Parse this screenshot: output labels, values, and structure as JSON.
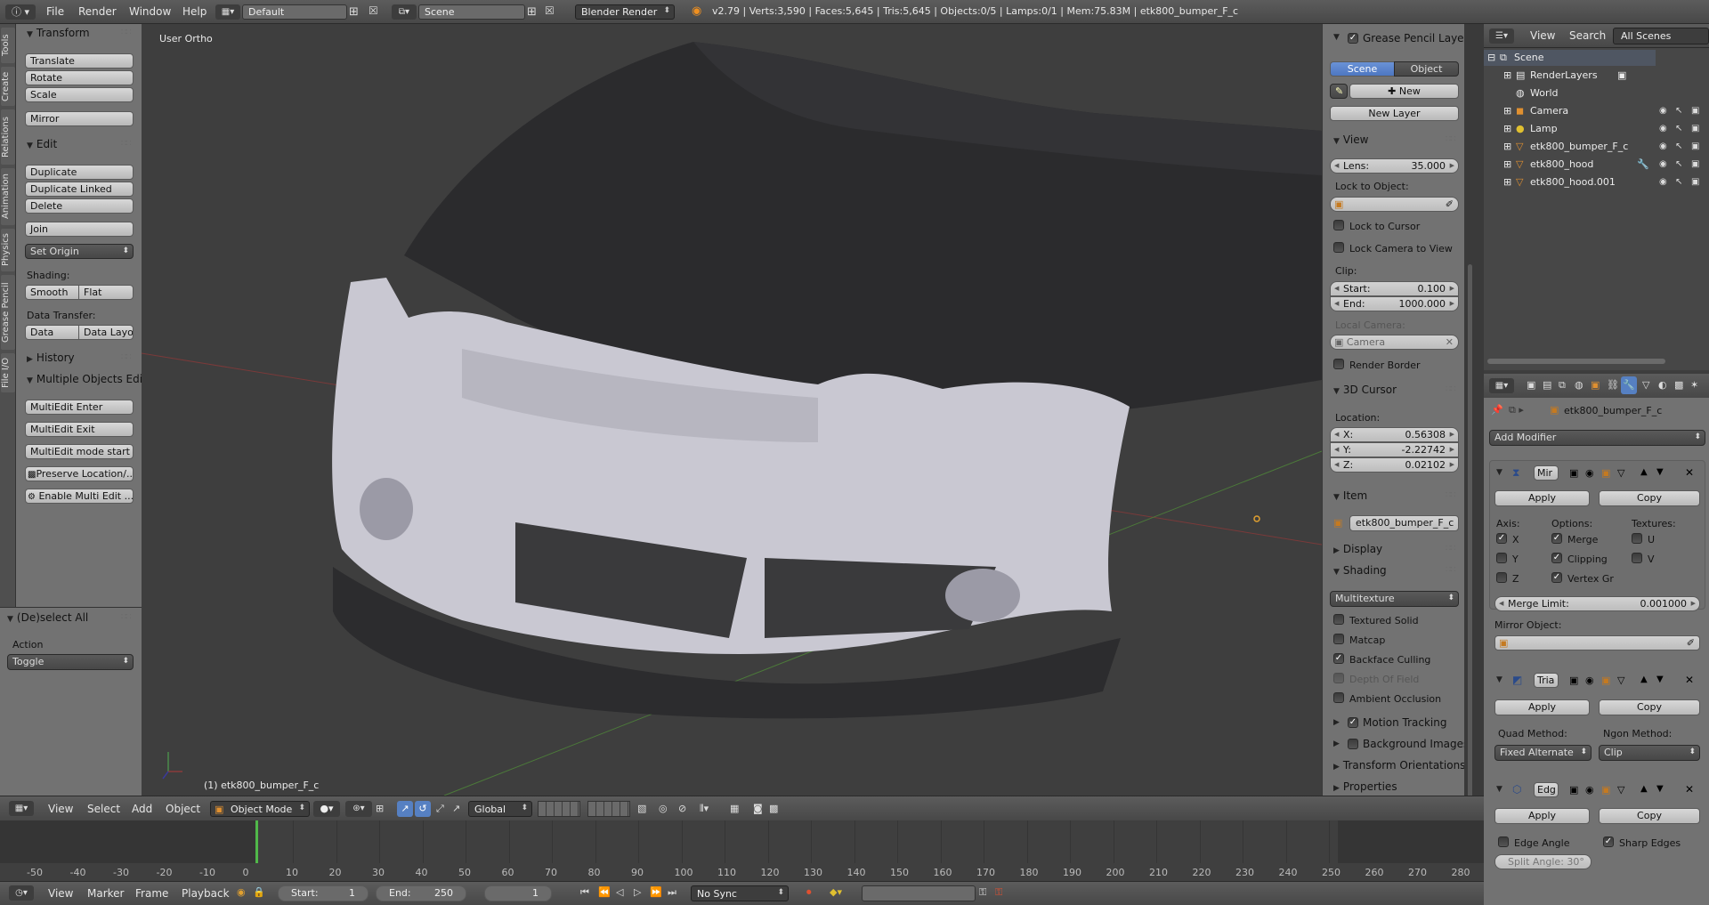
{
  "topbar": {
    "menus": [
      "File",
      "Render",
      "Window",
      "Help"
    ],
    "layout": "Default",
    "scene": "Scene",
    "engine": "Blender Render",
    "stats": "v2.79 | Verts:3,590 | Faces:5,645 | Tris:5,645 | Objects:0/5 | Lamps:0/1 | Mem:75.83M | etk800_bumper_F_c"
  },
  "tabs": [
    "Tools",
    "Create",
    "Relations",
    "Animation",
    "Physics",
    "Grease Pencil",
    "File I/O"
  ],
  "toolshelf": {
    "transform": {
      "title": "Transform",
      "buttons": [
        "Translate",
        "Rotate",
        "Scale",
        "Mirror"
      ]
    },
    "edit": {
      "title": "Edit",
      "buttons": [
        "Duplicate",
        "Duplicate Linked",
        "Delete",
        "Join"
      ],
      "set_origin": "Set Origin",
      "shading_label": "Shading:",
      "smooth": "Smooth",
      "flat": "Flat",
      "data_transfer_label": "Data Transfer:",
      "data": "Data",
      "data_layo": "Data Layo"
    },
    "history": "History",
    "multi": {
      "title": "Multiple Objects Edit",
      "buttons": [
        "MultiEdit Enter",
        "MultiEdit Exit",
        "MultiEdit mode start",
        "Preserve Location/...",
        "Enable Multi Edit ..."
      ]
    }
  },
  "operator": {
    "title": "(De)select All",
    "action_label": "Action",
    "action_value": "Toggle"
  },
  "viewport": {
    "view_name": "User Ortho",
    "object_label": "(1) etk800_bumper_F_c"
  },
  "npanel": {
    "grease": {
      "title": "Grease Pencil Layers",
      "scene": "Scene",
      "object": "Object",
      "new": "New",
      "new_layer": "New Layer"
    },
    "view": {
      "title": "View",
      "lens_label": "Lens:",
      "lens_value": "35.000",
      "lock_to_object": "Lock to Object:",
      "lock_cursor": "Lock to Cursor",
      "lock_camera": "Lock Camera to View",
      "clip": "Clip:",
      "start_label": "Start:",
      "start_value": "0.100",
      "end_label": "End:",
      "end_value": "1000.000",
      "local_camera": "Local Camera:",
      "camera": "Camera",
      "render_border": "Render Border"
    },
    "cursor": {
      "title": "3D Cursor",
      "location": "Location:",
      "x_label": "X:",
      "x": "0.56308",
      "y_label": "Y:",
      "y": "-2.22742",
      "z_label": "Z:",
      "z": "0.02102"
    },
    "item": {
      "title": "Item",
      "name": "etk800_bumper_F_c"
    },
    "display": "Display",
    "shading": {
      "title": "Shading",
      "mode": "Multitexture",
      "options": [
        "Textured Solid",
        "Matcap",
        "Backface Culling",
        "Depth Of Field",
        "Ambient Occlusion"
      ],
      "checked": [
        false,
        false,
        true,
        false,
        false
      ]
    },
    "motion_tracking": "Motion Tracking",
    "background_images": "Background Images",
    "transform_orientations": "Transform Orientations",
    "properties": "Properties"
  },
  "outliner": {
    "menus": [
      "View",
      "Search"
    ],
    "filter": "All Scenes",
    "items": [
      "Scene",
      "RenderLayers",
      "World",
      "Camera",
      "Lamp",
      "etk800_bumper_F_c",
      "etk800_hood",
      "etk800_hood.001"
    ]
  },
  "props": {
    "object": "etk800_bumper_F_c",
    "add_modifier": "Add Modifier",
    "mirror": {
      "name": "Mir",
      "apply": "Apply",
      "copy": "Copy",
      "axis_label": "Axis:",
      "options_label": "Options:",
      "textures_label": "Textures:",
      "x": "X",
      "y": "Y",
      "z": "Z",
      "merge": "Merge",
      "clipping": "Clipping",
      "vertex_gr": "Vertex Gr",
      "u": "U",
      "v": "V",
      "merge_limit_label": "Merge Limit:",
      "merge_limit": "0.001000",
      "mirror_object": "Mirror Object:"
    },
    "triangulate": {
      "name": "Tria",
      "apply": "Apply",
      "copy": "Copy",
      "quad_label": "Quad Method:",
      "ngon_label": "Ngon Method:",
      "quad_value": "Fixed Alternate",
      "ngon_value": "Clip"
    },
    "edge": {
      "name": "Edg",
      "apply": "Apply",
      "copy": "Copy",
      "edge_angle": "Edge Angle",
      "sharp_edges": "Sharp Edges",
      "split_angle": "Split Angle: 30°"
    }
  },
  "vp_header": {
    "menus": [
      "View",
      "Select",
      "Add",
      "Object"
    ],
    "mode": "Object Mode",
    "orientation": "Global"
  },
  "timeline": {
    "ticks": [
      "-50",
      "-40",
      "-30",
      "-20",
      "-10",
      "0",
      "10",
      "20",
      "30",
      "40",
      "50",
      "60",
      "70",
      "80",
      "90",
      "100",
      "110",
      "120",
      "130",
      "140",
      "150",
      "160",
      "170",
      "180",
      "190",
      "200",
      "210",
      "220",
      "230",
      "240",
      "250",
      "260",
      "270",
      "280"
    ],
    "menus": [
      "View",
      "Marker",
      "Frame",
      "Playback"
    ],
    "start_label": "Start:",
    "start": "1",
    "end_label": "End:",
    "end": "250",
    "current": "1",
    "sync": "No Sync"
  },
  "colors": {
    "accent": "#5680c2",
    "viewport_bg": "#3e3e3e",
    "panel": "#727272"
  }
}
